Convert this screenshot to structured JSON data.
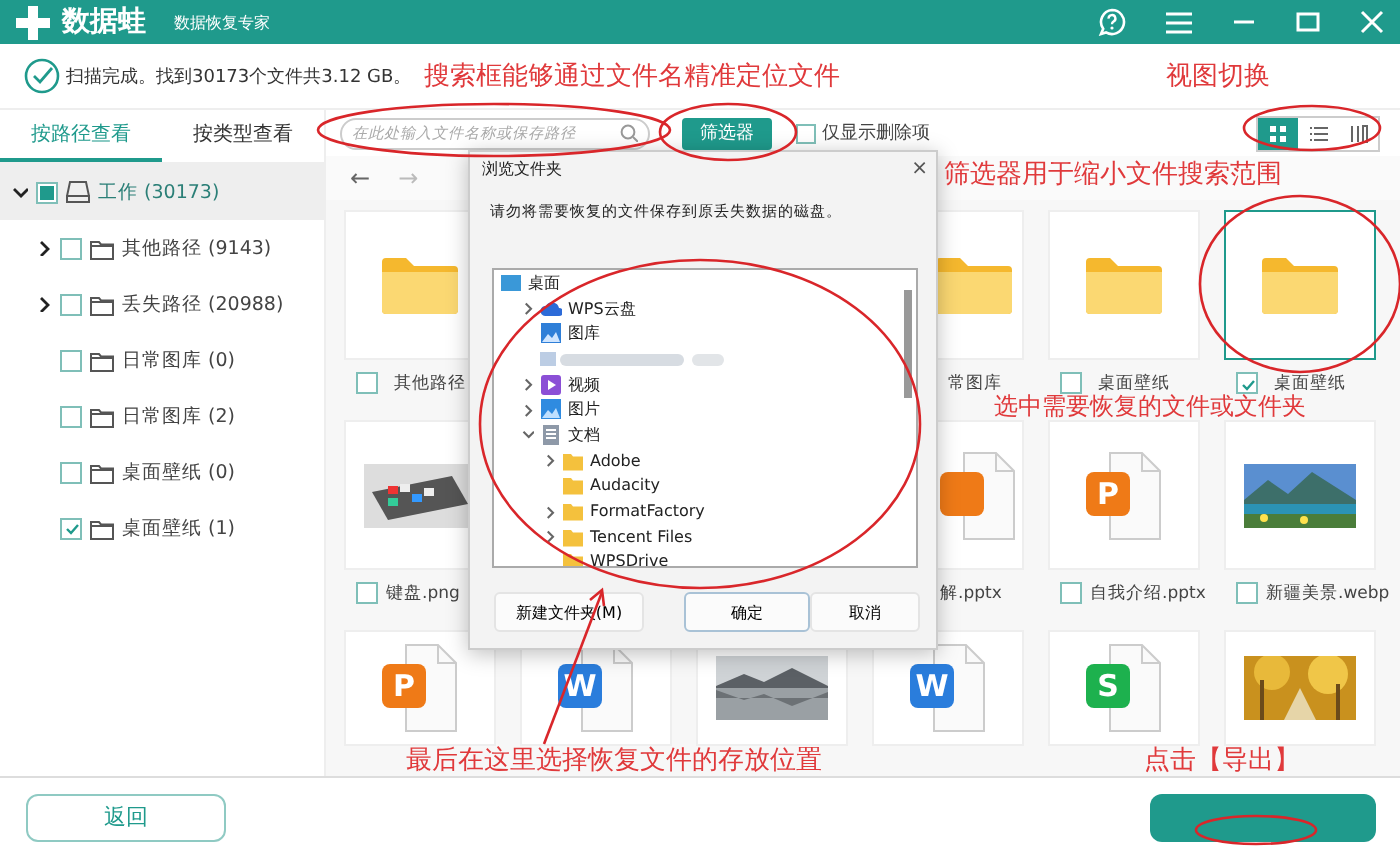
{
  "app": {
    "logo": "数据蛙",
    "subtitle": "数据恢复专家"
  },
  "status": {
    "text": "扫描完成。找到30173个文件共3.12 GB。"
  },
  "sidebar": {
    "tabs": [
      {
        "label": "按路径查看",
        "selected": true
      },
      {
        "label": "按类型查看",
        "selected": false
      }
    ],
    "tree": [
      {
        "label": "工作 (30173)",
        "kind": "drive",
        "expanded": true,
        "checked": false,
        "mixed": true,
        "selected": true,
        "children": [
          {
            "label": "其他路径 (9143)",
            "kind": "folder",
            "expanded": false,
            "checked": false,
            "mixed": false,
            "selected": false
          },
          {
            "label": "丢失路径 (20988)",
            "kind": "folder",
            "expanded": false,
            "checked": false,
            "mixed": false,
            "selected": false
          },
          {
            "label": "日常图库 (0)",
            "kind": "folder",
            "checked": false,
            "mixed": false,
            "selected": false
          },
          {
            "label": "日常图库 (2)",
            "kind": "folder",
            "checked": false,
            "mixed": false,
            "selected": false
          },
          {
            "label": "桌面壁纸 (0)",
            "kind": "folder",
            "checked": false,
            "mixed": false,
            "selected": false
          },
          {
            "label": "桌面壁纸 (1)",
            "kind": "folder",
            "checked": true,
            "mixed": false,
            "selected": false
          }
        ]
      }
    ]
  },
  "toolbar": {
    "search": {
      "placeholder": "在此处输入文件名称或保存路径"
    },
    "filter_button": "筛选器",
    "deleted_only": {
      "label": "仅显示删除项",
      "checked": false
    },
    "views": [
      {
        "kind": "grid",
        "selected": true
      },
      {
        "kind": "list",
        "selected": false
      },
      {
        "kind": "columns",
        "selected": false
      }
    ]
  },
  "nav": [
    {
      "label": "←",
      "disabled": false
    },
    {
      "label": "→",
      "disabled": true
    }
  ],
  "grid": {
    "rows": [
      {
        "cells": [
          {
            "kind": "folder",
            "label": "其他路径",
            "checked": false,
            "selected": false
          },
          null,
          null,
          {
            "kind": "folder",
            "label": "常图库",
            "selected": false
          },
          {
            "kind": "folder",
            "label": "桌面壁纸",
            "checked": false,
            "selected": false
          },
          {
            "kind": "folder",
            "label": "桌面壁纸",
            "checked": true,
            "selected": true
          }
        ]
      },
      {
        "cells": [
          {
            "kind": "picture",
            "label": "键盘.png",
            "checked": false,
            "selected": false
          },
          null,
          null,
          {
            "kind": "pptx",
            "label": "解.pptx",
            "selected": false
          },
          {
            "kind": "pptx",
            "icon_letter": "P",
            "label": "自我介绍.pptx",
            "checked": false,
            "selected": false
          },
          {
            "kind": "picture",
            "label": "新疆美景.webp",
            "checked": false,
            "selected": false
          }
        ]
      },
      {
        "cells": [
          {
            "kind": "pptx",
            "icon_letter": "P",
            "selected": false
          },
          {
            "kind": "docx",
            "icon_letter": "W",
            "selected": false
          },
          {
            "kind": "picture",
            "selected": false
          },
          {
            "kind": "docx",
            "icon_letter": "W",
            "selected": false
          },
          {
            "kind": "xlsx",
            "icon_letter": "S",
            "selected": false
          },
          {
            "kind": "picture",
            "selected": false
          }
        ]
      }
    ]
  },
  "dialog": {
    "title": "浏览文件夹",
    "close": "×",
    "message": "请勿将需要恢复的文件保存到原丢失数据的磁盘。",
    "tree": [
      {
        "label": "桌面",
        "kind": "desktop",
        "children": [
          {
            "label": "WPS云盘",
            "kind": "cloud",
            "expanded": false
          },
          {
            "label": "图库",
            "kind": "gallery"
          },
          {
            "kind": "blurred"
          },
          {
            "label": "视频",
            "kind": "video",
            "expanded": false
          },
          {
            "label": "图片",
            "kind": "pictures",
            "expanded": false
          },
          {
            "label": "文档",
            "kind": "documents",
            "expanded": true,
            "children": [
              {
                "label": "Adobe",
                "kind": "folder",
                "expanded": false
              },
              {
                "label": "Audacity",
                "kind": "folder"
              },
              {
                "label": "FormatFactory",
                "kind": "folder",
                "expanded": false
              },
              {
                "label": "Tencent Files",
                "kind": "folder",
                "expanded": false
              },
              {
                "label": "WPSDrive",
                "kind": "folder"
              }
            ]
          }
        ]
      }
    ],
    "buttons": [
      {
        "label": "新建文件夹(M)",
        "default": false
      },
      {
        "label": "确定",
        "default": true
      },
      {
        "label": "取消",
        "default": false
      }
    ]
  },
  "bottom": {
    "back_button": "返回",
    "export_button": {
      "primary": true
    }
  },
  "annotations": {
    "notes": [
      {
        "text": "搜索框能够通过文件名精准定位文件"
      },
      {
        "text": "视图切换"
      },
      {
        "text": "筛选器用于缩小文件搜索范围"
      },
      {
        "text": "选中需要恢复的文件或文件夹"
      },
      {
        "text": "最后在这里选择恢复文件的存放位置"
      },
      {
        "text": "点击【导出】"
      }
    ]
  }
}
